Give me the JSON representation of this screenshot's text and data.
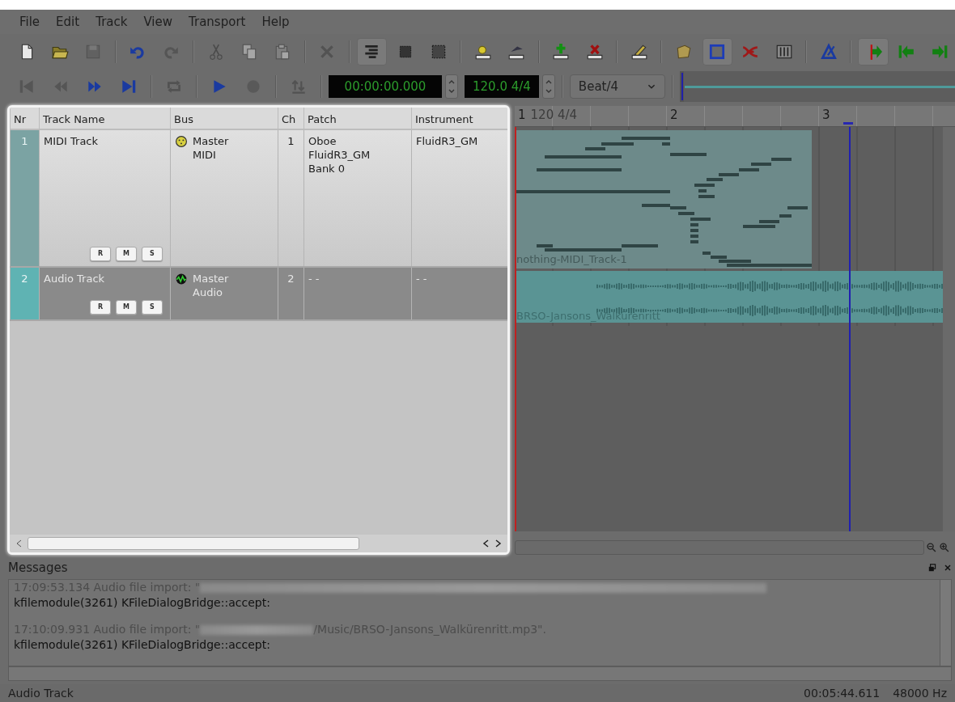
{
  "menu": [
    {
      "label": "File"
    },
    {
      "label": "Edit"
    },
    {
      "label": "Track"
    },
    {
      "label": "View"
    },
    {
      "label": "Transport"
    },
    {
      "label": "Help"
    }
  ],
  "toolbar": {
    "groups": [
      [
        {
          "kind": "new",
          "disabled": false,
          "pressed": false
        },
        {
          "kind": "open",
          "disabled": false,
          "pressed": false
        },
        {
          "kind": "save",
          "disabled": true,
          "pressed": false
        }
      ],
      [
        {
          "kind": "undo",
          "disabled": false,
          "pressed": false
        },
        {
          "kind": "redo",
          "disabled": true,
          "pressed": false
        }
      ],
      [
        {
          "kind": "cut",
          "disabled": true,
          "pressed": false
        },
        {
          "kind": "copy",
          "disabled": true,
          "pressed": false
        },
        {
          "kind": "paste",
          "disabled": true,
          "pressed": false
        }
      ],
      [
        {
          "kind": "delete",
          "disabled": true,
          "pressed": false
        }
      ],
      [
        {
          "kind": "bars",
          "disabled": false,
          "pressed": true
        },
        {
          "kind": "selbox",
          "disabled": false,
          "pressed": false
        },
        {
          "kind": "seldot",
          "disabled": false,
          "pressed": false
        }
      ],
      [
        {
          "kind": "sun",
          "disabled": false,
          "pressed": false
        },
        {
          "kind": "import",
          "disabled": false,
          "pressed": false
        }
      ],
      [
        {
          "kind": "addtrack",
          "disabled": false,
          "pressed": false
        },
        {
          "kind": "removetrack",
          "disabled": false,
          "pressed": false
        }
      ],
      [
        {
          "kind": "pencil",
          "disabled": false,
          "pressed": false
        }
      ],
      [
        {
          "kind": "folder",
          "disabled": false,
          "pressed": false
        },
        {
          "kind": "square",
          "disabled": false,
          "pressed": true
        },
        {
          "kind": "split",
          "disabled": false,
          "pressed": false
        },
        {
          "kind": "mixer",
          "disabled": false,
          "pressed": false
        }
      ],
      [
        {
          "kind": "metronome",
          "disabled": false,
          "pressed": false
        }
      ],
      [
        {
          "kind": "follow",
          "disabled": false,
          "pressed": true
        },
        {
          "kind": "left",
          "disabled": false,
          "pressed": false
        },
        {
          "kind": "right",
          "disabled": false,
          "pressed": false
        }
      ]
    ]
  },
  "transport": {
    "groups": [
      [
        {
          "kind": "start",
          "disabled": true
        },
        {
          "kind": "rewind",
          "disabled": true
        },
        {
          "kind": "forward",
          "disabled": false
        },
        {
          "kind": "end",
          "disabled": false
        }
      ],
      [
        {
          "kind": "loop",
          "disabled": true
        }
      ],
      [
        {
          "kind": "play",
          "disabled": false
        },
        {
          "kind": "record",
          "disabled": true
        }
      ],
      [
        {
          "kind": "punch",
          "disabled": true
        }
      ]
    ],
    "time": "00:00:00.000",
    "tempo": "120.0 4/4",
    "snap": "Beat/4"
  },
  "tracks": {
    "columns": [
      "Nr",
      "Track Name",
      "Bus",
      "Ch",
      "Patch",
      "Instrument"
    ],
    "rows": [
      {
        "nr": "1",
        "name": "MIDI Track",
        "kind": "midi",
        "bus": [
          "Master",
          "MIDI"
        ],
        "ch": "1",
        "patch": [
          "Oboe",
          "FluidR3_GM",
          "Bank 0"
        ],
        "instrument": "FluidR3_GM",
        "buttons": [
          "R",
          "M",
          "S"
        ],
        "selected": false
      },
      {
        "nr": "2",
        "name": "Audio Track",
        "kind": "audio",
        "bus": [
          "Master",
          "Audio"
        ],
        "ch": "2",
        "patch": [
          "- -"
        ],
        "instrument": "- -",
        "buttons": [
          "R",
          "M",
          "S"
        ],
        "selected": true
      }
    ]
  },
  "arranger": {
    "bars": [
      {
        "number": "1",
        "tempo": "120 4/4"
      },
      {
        "number": "2"
      },
      {
        "number": "3"
      }
    ],
    "parts": [
      {
        "kind": "midi",
        "label": "nothing-MIDI_Track-1"
      },
      {
        "kind": "audio",
        "label": "BRSO-Jansons_Walkürenritt"
      }
    ]
  },
  "messages": {
    "title": "Messages",
    "lines": [
      {
        "kind": "faded",
        "parts": [
          {
            "kind": "text",
            "text": "17:09:53.134 Audio file import: \""
          },
          {
            "kind": "redacted"
          }
        ]
      },
      {
        "kind": "normal",
        "parts": [
          {
            "kind": "text",
            "text": "kfilemodule(3261) KFileDialogBridge::accept:"
          }
        ]
      },
      {
        "kind": "faded",
        "parts": [
          {
            "kind": "text",
            "text": "17:10:09.931 Audio file import: \""
          },
          {
            "kind": "redacted"
          },
          {
            "kind": "text",
            "text": "/Music/BRSO-Jansons_Walkürenritt.mp3\"."
          }
        ]
      },
      {
        "kind": "normal",
        "parts": [
          {
            "kind": "text",
            "text": "kfilemodule(3261) KFileDialogBridge::accept:"
          }
        ]
      }
    ]
  },
  "status_bar": {
    "track": "Audio Track",
    "time": "00:05:44.611",
    "rate": "48000 Hz"
  }
}
